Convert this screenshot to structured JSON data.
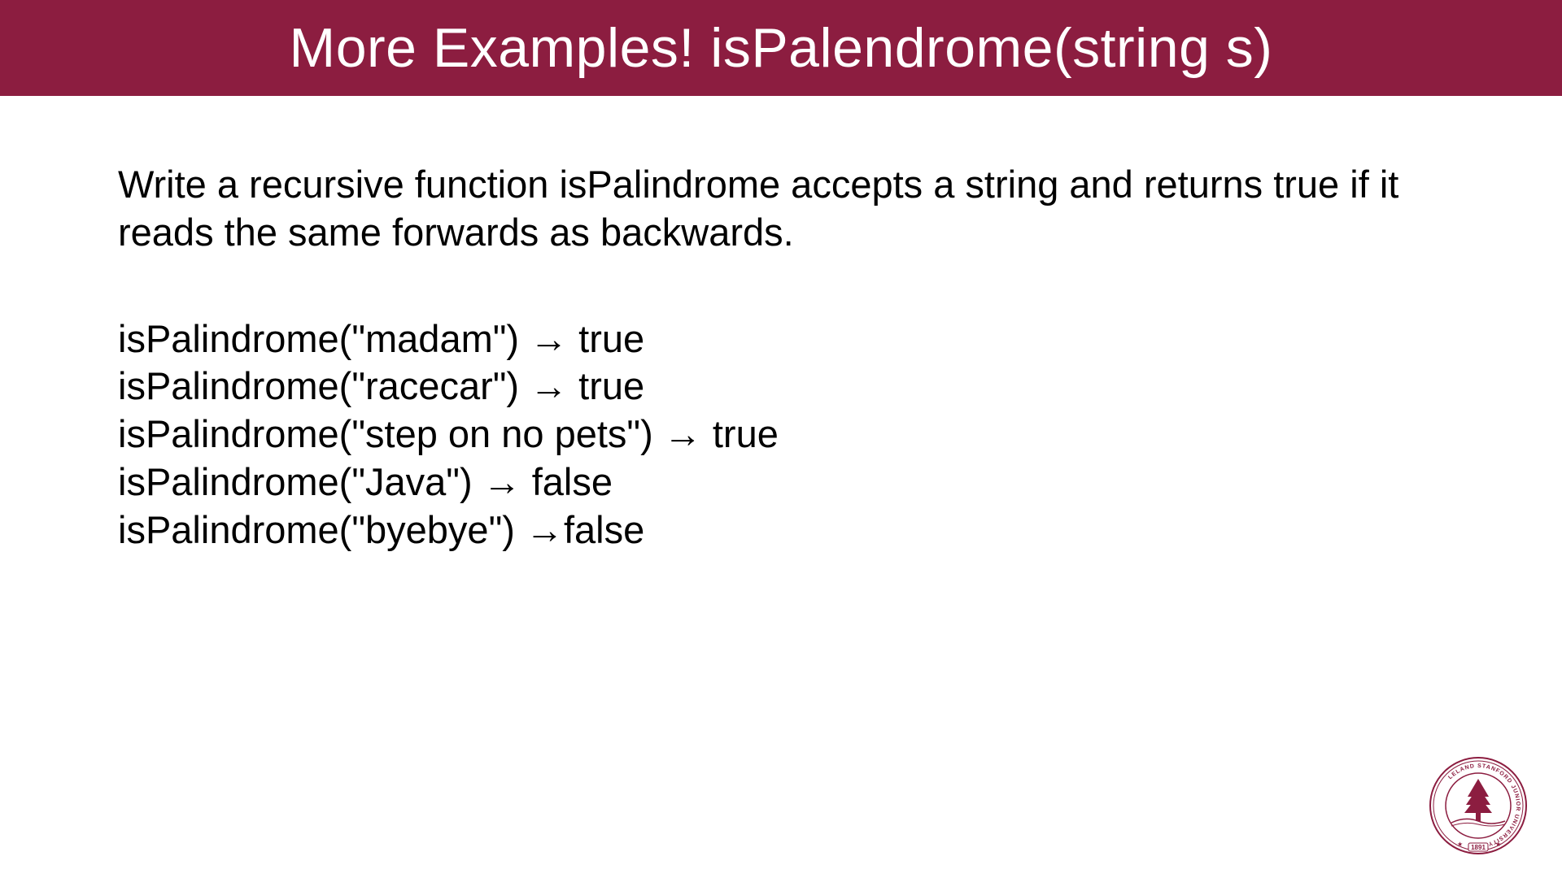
{
  "header": {
    "title": "More Examples! isPalendrome(string s)"
  },
  "content": {
    "description": "Write a recursive function isPalindrome accepts a string and returns true if it reads the same forwards as backwards.",
    "examples": [
      "isPalindrome(\"madam\") → true",
      "isPalindrome(\"racecar\") → true",
      "isPalindrome(\"step on no pets\") → true",
      "isPalindrome(\"Java\") → false",
      "isPalindrome(\"byebye\") →false"
    ]
  },
  "seal": {
    "outer_text": "LELAND STANFORD JUNIOR UNIVERSITY",
    "year": "1891"
  }
}
